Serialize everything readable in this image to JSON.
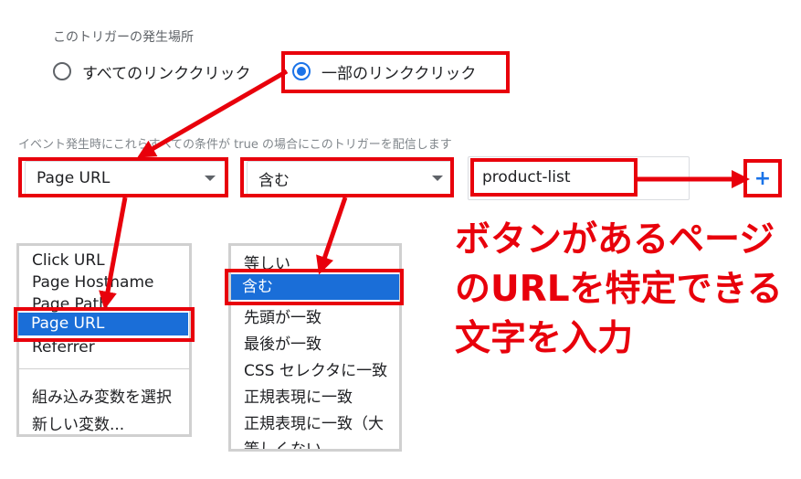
{
  "trigger": {
    "section_label": "このトリガーの発生場所",
    "radio_all": "すべてのリンククリック",
    "radio_some": "一部のリンククリック"
  },
  "condition": {
    "label": "イベント発生時にこれらすべての条件が true の場合にこのトリガーを配信します",
    "variable": "Page URL",
    "operator": "含む",
    "value": "product-list",
    "add_label": "+"
  },
  "variable_menu": {
    "items": [
      "Click URL",
      "Page Hostname",
      "Page Path",
      "Page URL",
      "Referrer"
    ],
    "selected": "Page URL",
    "extra": [
      "組み込み変数を選択",
      "新しい変数..."
    ]
  },
  "operator_menu": {
    "items": [
      "等しい",
      "含む",
      "先頭が一致",
      "最後が一致",
      "CSS セレクタに一致",
      "正規表現に一致",
      "正規表現に一致（大",
      "等しくない"
    ],
    "selected": "含む"
  },
  "annotation": {
    "lines": [
      "ボタンがあるページ",
      "のURLを特定できる",
      "文字を入力"
    ]
  },
  "colors": {
    "highlight_red": "#e8000b",
    "selection_blue": "#1a6ed8",
    "radio_blue": "#1a73e8"
  }
}
